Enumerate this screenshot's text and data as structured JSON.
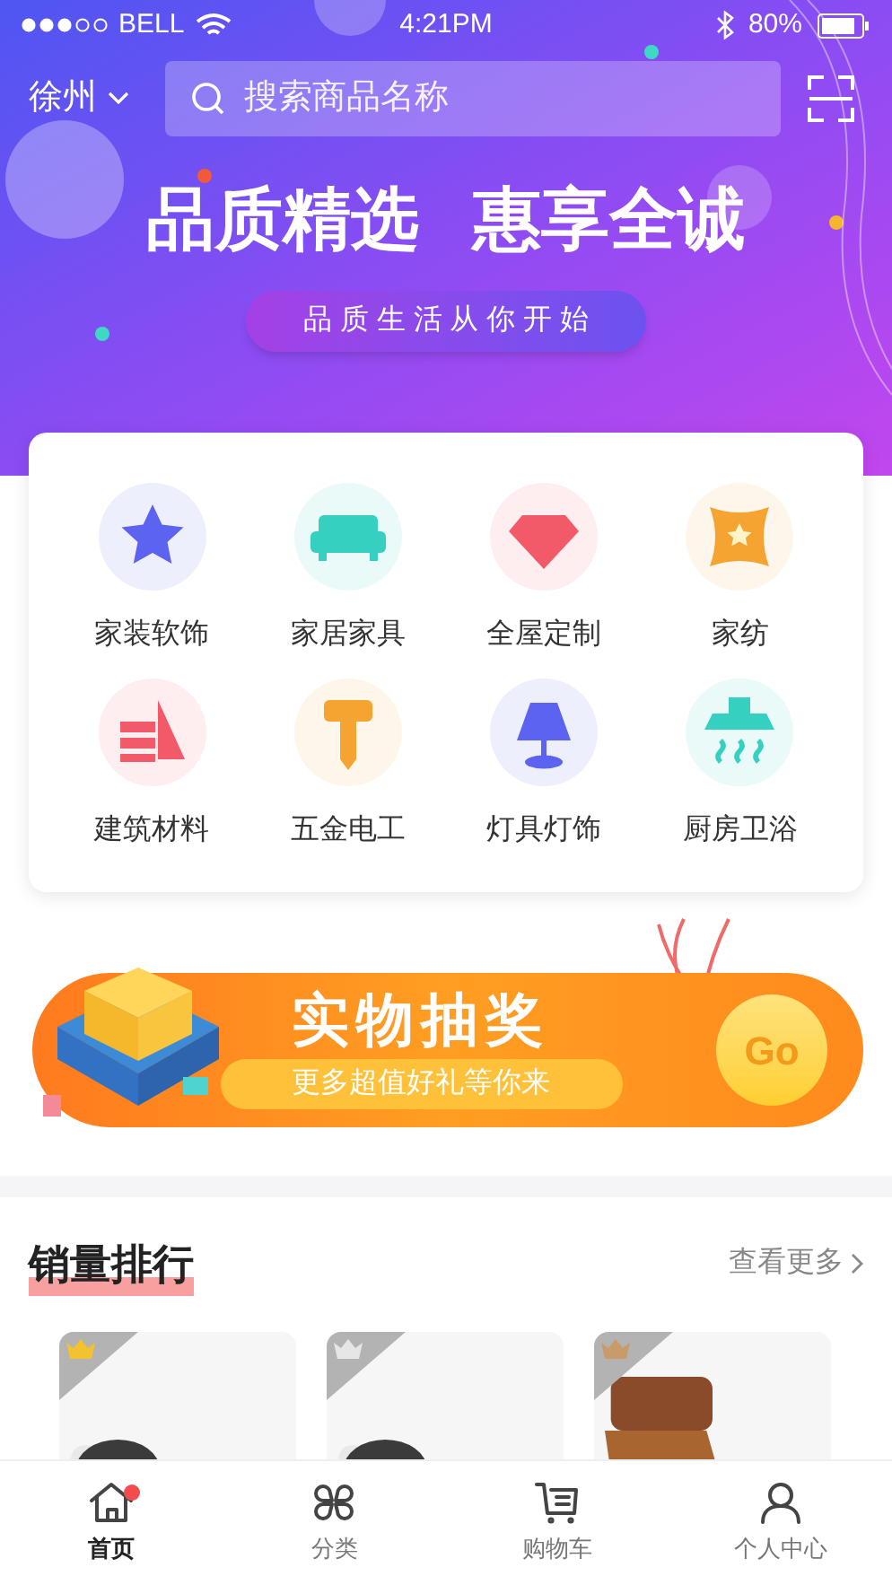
{
  "status_bar": {
    "carrier": "BELL",
    "time": "4:21PM",
    "battery": "80%"
  },
  "header": {
    "city": "徐州",
    "search": {
      "placeholder": "搜索商品名称"
    }
  },
  "hero": {
    "title": "品质精选",
    "title_2": "惠享全诚",
    "slogan": "品 质 生 活 从 你 开 始"
  },
  "categories": [
    {
      "label": "家装软饰",
      "kind": "star",
      "color": "#5b63f0"
    },
    {
      "label": "家居家具",
      "kind": "sofa",
      "color": "#35d0bf"
    },
    {
      "label": "全屋定制",
      "kind": "diamond",
      "color": "#f25a6a"
    },
    {
      "label": "家纺",
      "kind": "pillow",
      "color": "#f5a431"
    },
    {
      "label": "建筑材料",
      "kind": "blocks",
      "color": "#f25a6a"
    },
    {
      "label": "五金电工",
      "kind": "screw",
      "color": "#f5a431"
    },
    {
      "label": "灯具灯饰",
      "kind": "lamp",
      "color": "#5b63f0"
    },
    {
      "label": "厨房卫浴",
      "kind": "hood",
      "color": "#35d0bf"
    }
  ],
  "promo": {
    "title": "实物抽奖",
    "subtitle": "更多超值好礼等你来",
    "button": "Go"
  },
  "ranking": {
    "title": "销量排行",
    "more": "查看更多"
  },
  "tab_bar": [
    {
      "label": "首页",
      "kind": "home",
      "selected": true,
      "dot": true
    },
    {
      "label": "分类",
      "kind": "grid",
      "selected": false,
      "dot": false
    },
    {
      "label": "购物车",
      "kind": "cart",
      "selected": false,
      "dot": false
    },
    {
      "label": "个人中心",
      "kind": "user",
      "selected": false,
      "dot": false
    }
  ]
}
